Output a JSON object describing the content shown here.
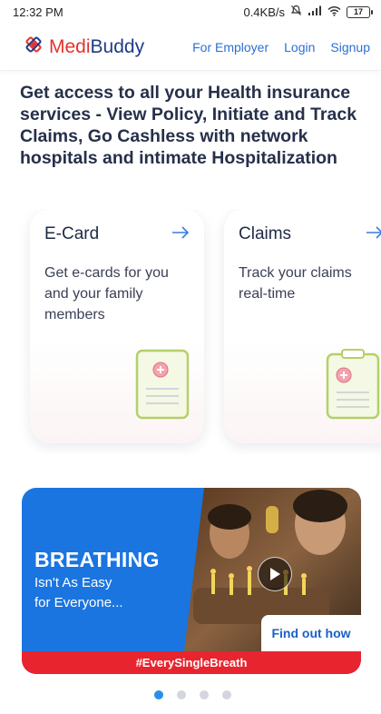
{
  "status_bar": {
    "time": "12:32 PM",
    "network_speed": "0.4KB/s",
    "battery": "17",
    "icons": [
      "mute-icon",
      "signal-icon",
      "wifi-icon",
      "battery-icon"
    ]
  },
  "header": {
    "brand": {
      "part1": "Medi",
      "part2": "Buddy"
    },
    "nav": [
      "For Employer",
      "Login",
      "Signup"
    ]
  },
  "headline": "Get access to all your Health insurance services - View Policy, Initiate and Track Claims, Go Cashless with network hospitals and intimate Hospitalization",
  "cards": [
    {
      "title": "E-Card",
      "desc": "Get e-cards for you and your family members",
      "icon": "ecard-icon"
    },
    {
      "title": "Claims",
      "desc": "Track your claims real-time",
      "icon": "clipboard-icon"
    }
  ],
  "banner": {
    "headline": "BREATHING",
    "sub_line1": "Isn't As  Easy",
    "sub_line2": "for Everyone...",
    "cta": "Find out how",
    "hashtag": "#EverySingleBreath"
  },
  "carousel": {
    "count": 4,
    "active": 0
  },
  "colors": {
    "brand_red": "#e5322d",
    "brand_blue": "#1f3b88",
    "link": "#2a6fd6",
    "banner_blue": "#1b75e0",
    "banner_red": "#e8242e",
    "dot_active": "#2a8fe8"
  }
}
